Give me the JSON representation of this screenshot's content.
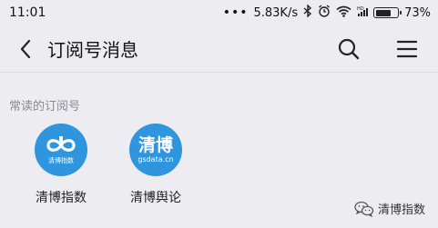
{
  "status_bar": {
    "time": "11:01",
    "dots": "•••",
    "speed": "5.83K/s",
    "battery": "73%",
    "battery_level": 0.73
  },
  "nav": {
    "title": "订阅号消息"
  },
  "section": {
    "label": "常读的订阅号"
  },
  "accounts": [
    {
      "name": "清博指数",
      "avatar_text": "清博指数",
      "icon": "infinity-logo"
    },
    {
      "name": "清博舆论",
      "avatar_text": "清博",
      "avatar_sub": "gsdata.cn"
    }
  ],
  "watermark": {
    "text": "清博指数",
    "icon": "wechat-icon"
  },
  "colors": {
    "background": "#edecf1",
    "avatar_blue": "#2e95de"
  }
}
